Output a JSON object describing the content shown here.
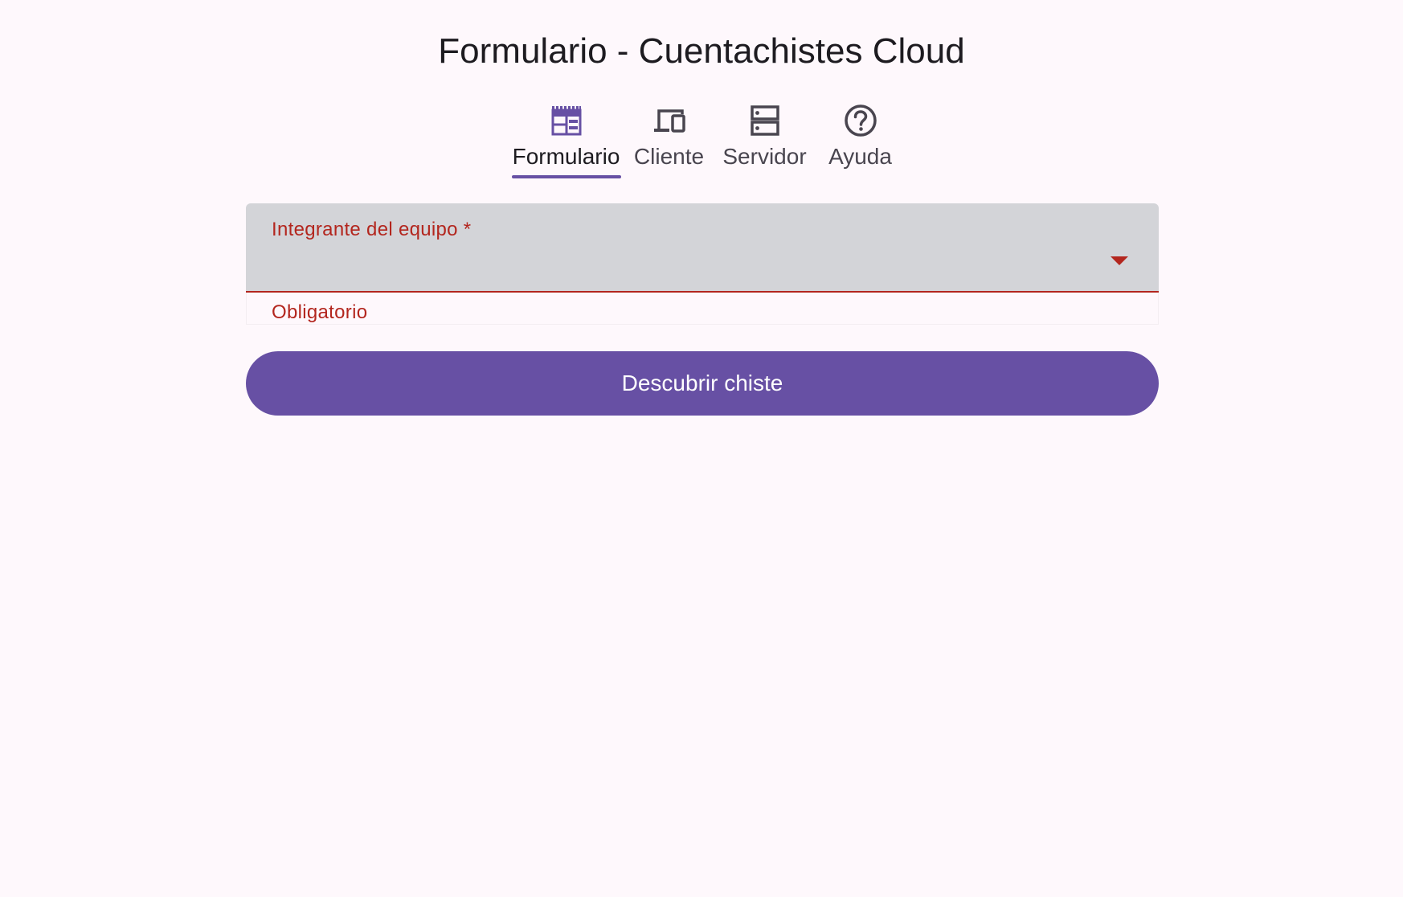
{
  "page": {
    "title": "Formulario - Cuentachistes Cloud"
  },
  "tabs": [
    {
      "label": "Formulario",
      "icon": "form-table-icon",
      "active": true
    },
    {
      "label": "Cliente",
      "icon": "devices-icon",
      "active": false
    },
    {
      "label": "Servidor",
      "icon": "server-icon",
      "active": false
    },
    {
      "label": "Ayuda",
      "icon": "help-circle-icon",
      "active": false
    }
  ],
  "form": {
    "member_field": {
      "label": "Integrante del equipo *",
      "value": "",
      "helper_text": "Obligatorio",
      "state": "error"
    },
    "submit_label": "Descubrir chiste"
  },
  "colors": {
    "primary": "#6750a4",
    "error": "#b3261e",
    "field_background": "#d3d4d8",
    "page_background": "#fef8fc"
  }
}
